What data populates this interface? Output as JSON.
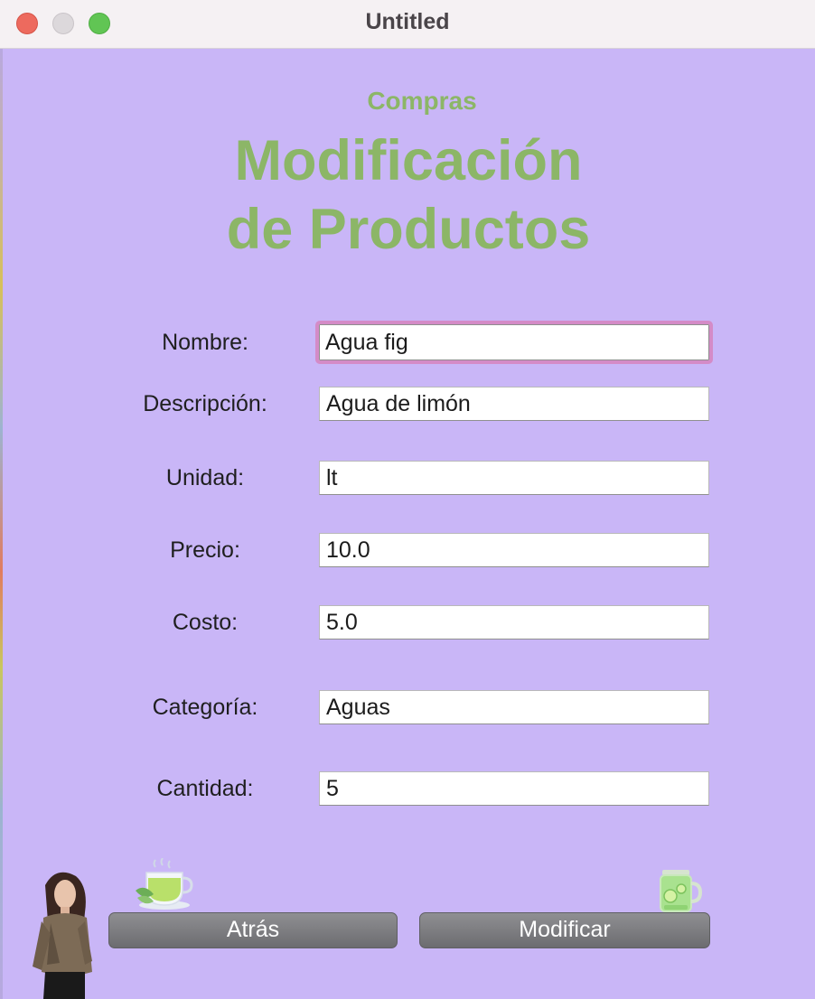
{
  "window": {
    "title": "Untitled"
  },
  "header": {
    "subtitle": "Compras",
    "title_line1": "Modificación",
    "title_line2": "de Productos"
  },
  "form": {
    "nombre": {
      "label": "Nombre:",
      "value": "Agua fig"
    },
    "descripcion": {
      "label": "Descripción:",
      "value": "Agua de limón"
    },
    "unidad": {
      "label": "Unidad:",
      "value": "lt"
    },
    "precio": {
      "label": "Precio:",
      "value": "10.0"
    },
    "costo": {
      "label": "Costo:",
      "value": "5.0"
    },
    "categoria": {
      "label": "Categoría:",
      "value": "Aguas"
    },
    "cantidad": {
      "label": "Cantidad:",
      "value": "5"
    }
  },
  "buttons": {
    "back": "Atrás",
    "modify": "Modificar"
  },
  "colors": {
    "background": "#c9b6f7",
    "heading": "#8cb667",
    "focus_ring": "#d48bc7",
    "button": "#7a7a7e"
  },
  "icons": {
    "tea": "tea-cup-icon",
    "drink": "lemon-drink-jar-icon",
    "person": "woman-photo"
  }
}
